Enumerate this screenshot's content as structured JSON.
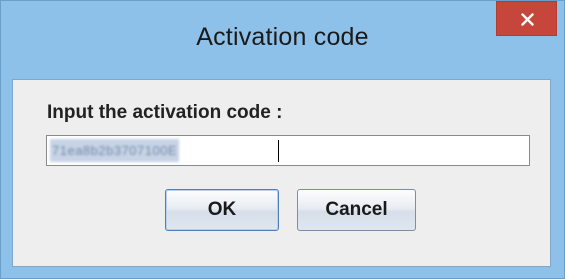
{
  "window": {
    "title": "Activation code",
    "close_icon": "close-icon"
  },
  "form": {
    "prompt_label": "Input the activation code :",
    "code_value": "71ea8b2b3707100E"
  },
  "buttons": {
    "ok_label": "OK",
    "cancel_label": "Cancel"
  },
  "colors": {
    "frame": "#8ec1ea",
    "close_button": "#c7463c",
    "client_background": "#eeeeee",
    "selection": "#c8d4e6"
  }
}
